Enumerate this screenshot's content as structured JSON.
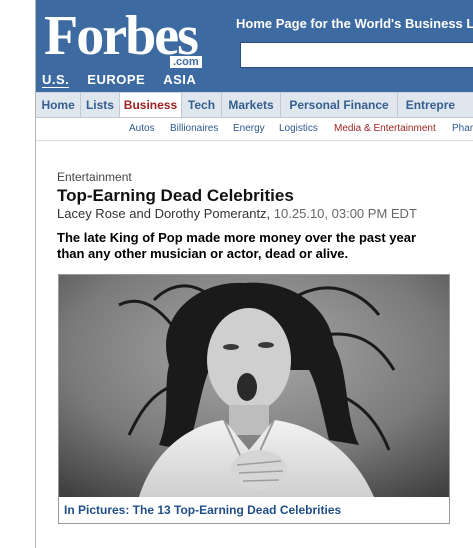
{
  "header": {
    "logo": "Forbes",
    "logo_suffix": ".com",
    "tagline": "Home Page for the World's Business L",
    "editions": [
      "U.S.",
      "EUROPE",
      "ASIA"
    ]
  },
  "search": {
    "value": ""
  },
  "main_nav": [
    "Home",
    "Lists",
    "Business",
    "Tech",
    "Markets",
    "Personal Finance",
    "Entrepre"
  ],
  "main_nav_active": "Business",
  "sub_nav": [
    "Autos",
    "Billionaires",
    "Energy",
    "Logistics",
    "Media & Entertainment",
    "Phar"
  ],
  "sub_nav_active": "Media & Entertainment",
  "article": {
    "section": "Entertainment",
    "title": "Top-Earning Dead Celebrities",
    "authors": "Lacey Rose and Dorothy Pomerantz,",
    "date": "10.25.10, 03:00 PM EDT",
    "dek": "The late King of Pop made more money over the past year than any other musician or actor, dead or alive.",
    "photo_caption": "In Pictures: The 13 Top-Earning Dead Celebrities"
  },
  "colors": {
    "header_blue": "#3d6aa0",
    "nav_bg": "#dfe6ee",
    "active_red": "#9a1f1f",
    "link_blue": "#1f4f86"
  }
}
